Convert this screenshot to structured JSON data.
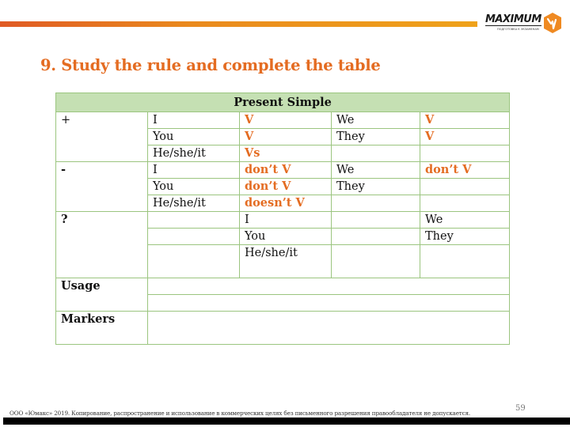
{
  "header": {
    "brand": {
      "name": "MAXIMUM",
      "tagline": "ПОДГОТОВКА К ЭКЗАМЕНАМ",
      "accent_color": "#e46c22"
    },
    "bar_colors": [
      "#e05a24",
      "#efa21b"
    ]
  },
  "title": "9. Study the rule and complete the table",
  "table": {
    "heading": "Present Simple",
    "border_color": "#9bc57f",
    "header_bg": "#c5e0b3",
    "answer_color": "#e46c22",
    "affirmative": {
      "label": "+",
      "rows": [
        {
          "pronoun": "I",
          "form": "V",
          "pronoun2": "We",
          "form2": "V"
        },
        {
          "pronoun": "You",
          "form": "V",
          "pronoun2": "They",
          "form2": "V"
        },
        {
          "pronoun": "He/she/it",
          "form": "Vs",
          "pronoun2": "",
          "form2": ""
        }
      ]
    },
    "negative": {
      "label": "-",
      "rows": [
        {
          "pronoun": "I",
          "form": "don’t V",
          "pronoun2": "We",
          "form2": "don’t V"
        },
        {
          "pronoun": "You",
          "form": "don’t V",
          "pronoun2": "They",
          "form2": ""
        },
        {
          "pronoun": "He/she/it",
          "form": "doesn’t V",
          "pronoun2": "",
          "form2": ""
        }
      ]
    },
    "question": {
      "label": "?",
      "rows": [
        {
          "aux": "",
          "pronoun": "I",
          "verb": "",
          "pronoun2": "We"
        },
        {
          "aux": "",
          "pronoun": "You",
          "verb": "",
          "pronoun2": "They"
        },
        {
          "aux": "",
          "pronoun": "He/she/it",
          "verb": "",
          "pronoun2": ""
        }
      ]
    },
    "usage": {
      "label": "Usage",
      "rows": [
        "",
        ""
      ]
    },
    "markers": {
      "label": "Markers",
      "value": ""
    }
  },
  "footer": {
    "copyright": "ООО «Юмакс» 2019. Копирование, распространение и использование в коммерческих целях без письменного разрешения правообладателя не допускается.",
    "page_number": "59"
  }
}
